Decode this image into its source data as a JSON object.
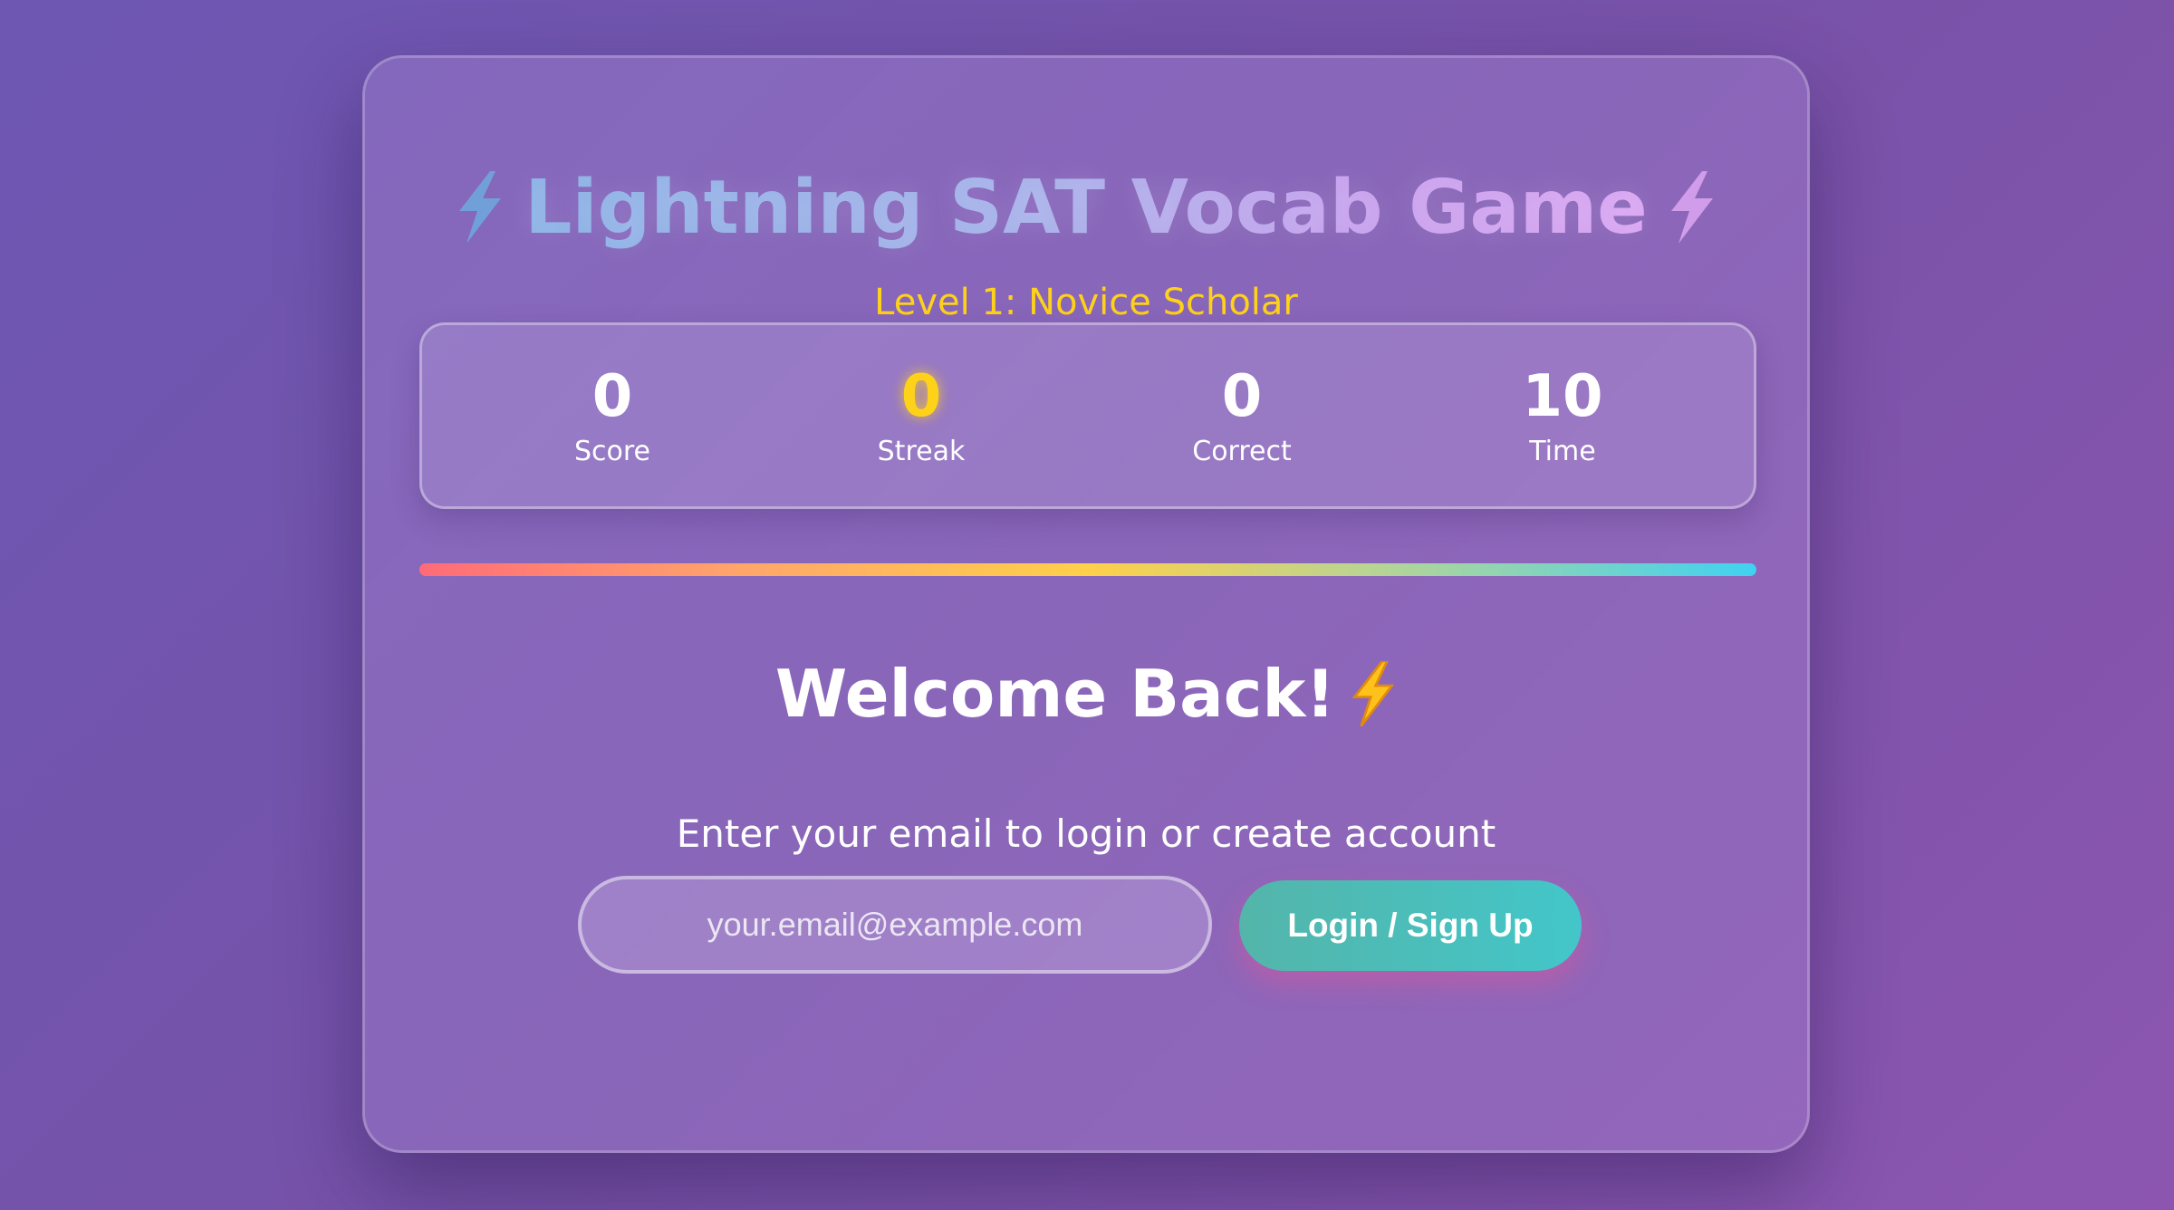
{
  "header": {
    "title": "Lightning SAT Vocab Game",
    "level": "Level 1: Novice Scholar",
    "left_icon": "lightning-bolt",
    "right_icon": "lightning-bolt"
  },
  "stats": [
    {
      "value": "0",
      "label": "Score"
    },
    {
      "value": "0",
      "label": "Streak"
    },
    {
      "value": "0",
      "label": "Correct"
    },
    {
      "value": "10",
      "label": "Time"
    }
  ],
  "progress": {
    "fraction": 1.0,
    "colors": [
      "#ff6b78",
      "#ffa86a",
      "#ffd04a",
      "#b6d496",
      "#40d2f2"
    ]
  },
  "login": {
    "heading": "Welcome Back!",
    "heading_icon": "lightning-bolt",
    "subtitle": "Enter your email to login or create account",
    "email_placeholder": "your.email@example.com",
    "email_value": "",
    "button_label": "Login / Sign Up"
  },
  "colors": {
    "accent": "#ffd21a",
    "button": "#47c0be",
    "background": "#7752a8"
  }
}
